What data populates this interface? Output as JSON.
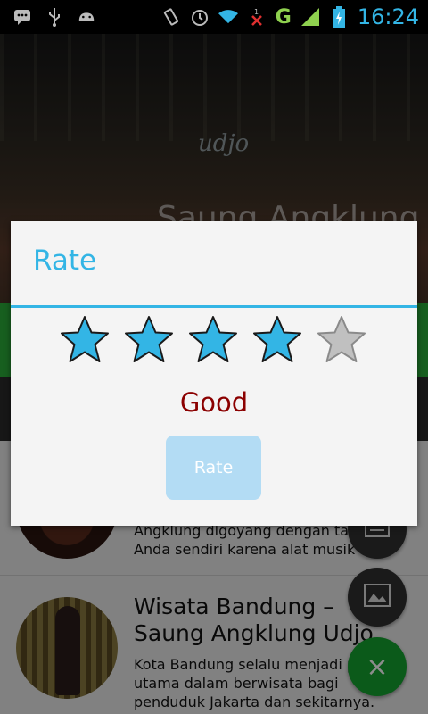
{
  "statusbar": {
    "left_icons": [
      "bbm-icon",
      "usb-icon",
      "android-icon"
    ],
    "network": "G",
    "time": "16:24"
  },
  "header": {
    "logo": "udjo",
    "title": "Saung Angklung"
  },
  "list": {
    "items": [
      {
        "title": "",
        "body_lines": [
          "Angklung digoyang dengan tan",
          "Anda sendiri karena alat musik"
        ]
      },
      {
        "title_lines": [
          "Wisata Bandung –",
          "Saung Angklung Udjo"
        ],
        "body_lines": [
          "Kota Bandung selalu menjadi p",
          "utama dalam berwisata bagi",
          "penduduk Jakarta dan sekitarnya."
        ]
      }
    ]
  },
  "fabs": {
    "close_symbol": "×"
  },
  "dialog": {
    "title": "Rate",
    "rating": 4,
    "max_rating": 5,
    "rating_label": "Good",
    "button_label": "Rate",
    "colors": {
      "accent": "#33b5e5",
      "star_filled": "#33b5e5",
      "star_empty": "#c0c0c0",
      "label": "#8b0000",
      "button": "#b3dcf4"
    }
  }
}
